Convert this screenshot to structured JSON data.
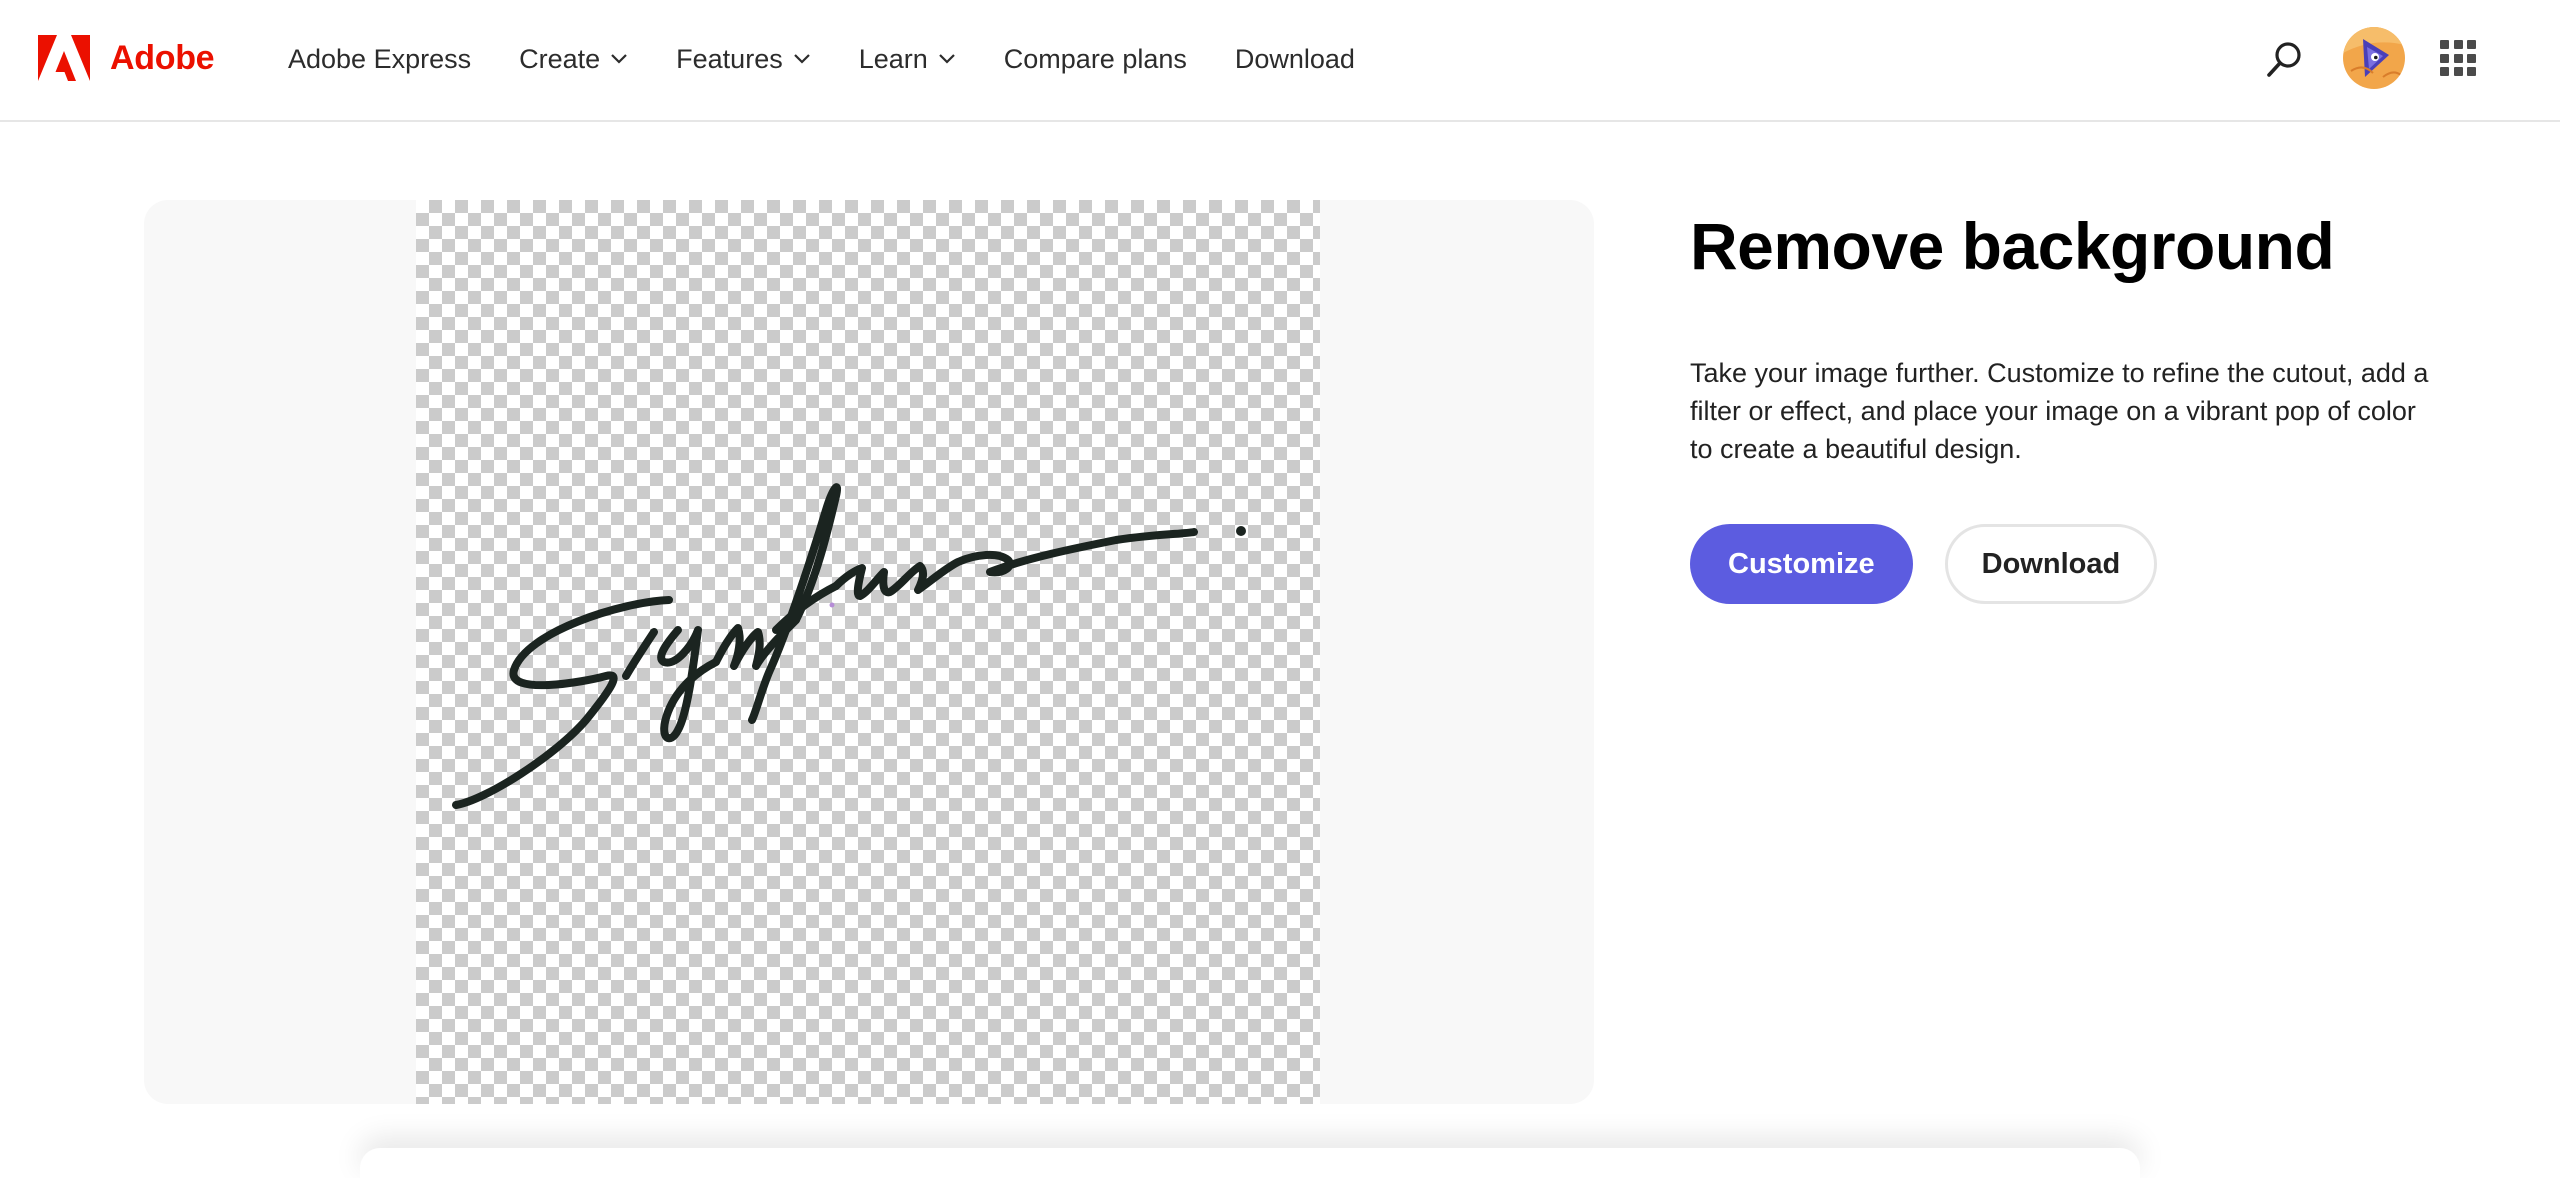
{
  "header": {
    "brand": "Adobe",
    "brand_color": "#eb1000",
    "brand_icon": "adobe-logo-icon",
    "nav": [
      {
        "label": "Adobe Express",
        "has_dropdown": false
      },
      {
        "label": "Create",
        "has_dropdown": true
      },
      {
        "label": "Features",
        "has_dropdown": true
      },
      {
        "label": "Learn",
        "has_dropdown": true
      },
      {
        "label": "Compare plans",
        "has_dropdown": false
      },
      {
        "label": "Download",
        "has_dropdown": false
      }
    ],
    "icons": {
      "search": "search-icon",
      "avatar": "user-avatar",
      "apps": "app-switcher-icon"
    }
  },
  "preview": {
    "background": "transparent-checkerboard",
    "image": "signature-cutout"
  },
  "info": {
    "title": "Remove background",
    "description": "Take your image further. Customize to refine the cutout, add a filter or effect, and place your image on a vibrant pop of color to create a beautiful design.",
    "customize_label": "Customize",
    "download_label": "Download"
  },
  "colors": {
    "accent": "#5c5ce0",
    "ink": "#1b2420"
  }
}
